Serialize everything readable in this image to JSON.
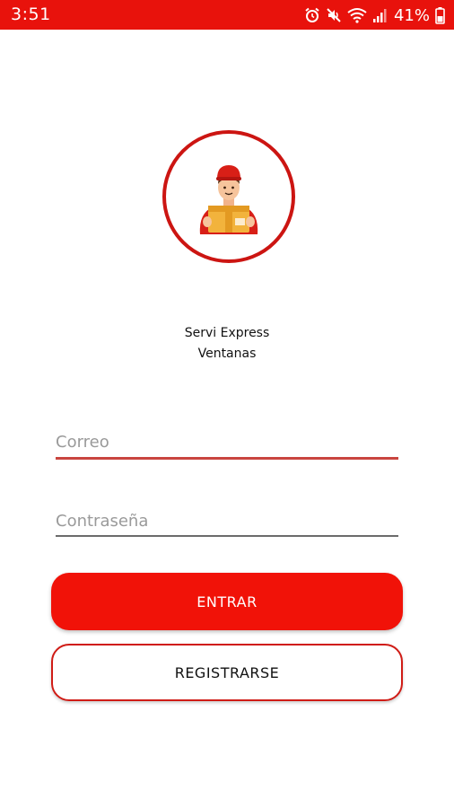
{
  "status_bar": {
    "time": "3:51",
    "battery": "41%",
    "background_color": "#e8120c",
    "icons": [
      "alarm-icon",
      "mute-icon",
      "wifi-icon",
      "signal-icon",
      "battery-icon"
    ]
  },
  "logo": {
    "icon": "delivery-person-icon",
    "border_color": "#cc1512"
  },
  "brand": {
    "line1": "Servi Express",
    "line2": "Ventanas"
  },
  "form": {
    "email": {
      "placeholder": "Correo",
      "value": ""
    },
    "password": {
      "placeholder": "Contraseña",
      "value": ""
    }
  },
  "buttons": {
    "login_label": "ENTRAR",
    "register_label": "REGISTRARSE",
    "accent_color": "#f11208"
  }
}
